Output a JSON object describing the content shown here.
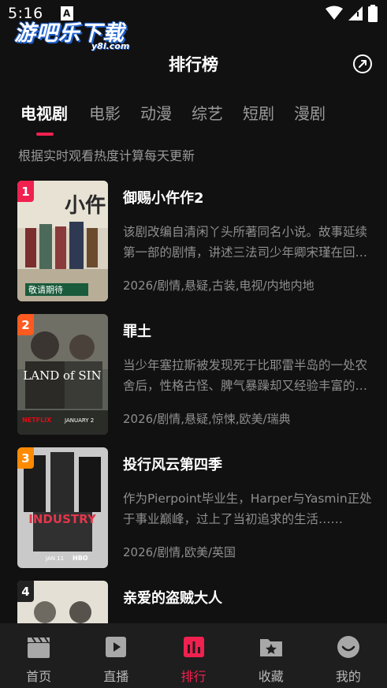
{
  "status": {
    "time": "5:16",
    "notif": "A"
  },
  "watermark": {
    "main": "游吧乐下载",
    "sub": "y8l.com"
  },
  "header": {
    "title": "排行榜"
  },
  "tabs": [
    "电视剧",
    "电影",
    "动漫",
    "综艺",
    "短剧",
    "漫剧"
  ],
  "subtitle": "根据实时观看热度计算每天更新",
  "items": [
    {
      "rank": "1",
      "title": "御赐小仵作2",
      "desc": "该剧改编自清闲丫头所著同名小说。故事延续第一部的剧情，讲述三法司少年卿宋瑾在回京途中，为调查一起离奇的案件……",
      "meta": "2026/剧情,悬疑,古装,电视/内地内地",
      "badge_color": "#f0214f",
      "poster_text": "敬请期待"
    },
    {
      "rank": "2",
      "title": "罪土",
      "desc": "当少年塞拉斯被发现死于比耶雷半岛的一处农舍后，性格古怪、脾气暴躁却又经验丰富的警探……",
      "meta": "2026/剧情,悬疑,惊悚,欧美/瑞典",
      "badge_color": "#ff5a1f",
      "poster_text": "LAND of SIN",
      "poster_brand": "NETFLIX",
      "poster_date": "JANUARY 2"
    },
    {
      "rank": "3",
      "title": "投行风云第四季",
      "desc": "作为Pierpoint毕业生，Harper与Yasmin正处于事业巅峰，过上了当初追求的生活……",
      "meta": "2026/剧情,欧美/英国",
      "badge_color": "#ff8a00",
      "poster_text": "INDUSTRY",
      "poster_brand": "HBO",
      "poster_date": "JAN 11"
    },
    {
      "rank": "4",
      "title": "亲爱的盗贼大人",
      "desc": "",
      "meta": "",
      "badge_color": "#222222"
    }
  ],
  "nav": [
    {
      "label": "首页",
      "icon": "clapperboard-icon"
    },
    {
      "label": "直播",
      "icon": "play-icon"
    },
    {
      "label": "排行",
      "icon": "ranking-bars-icon"
    },
    {
      "label": "收藏",
      "icon": "star-folder-icon"
    },
    {
      "label": "我的",
      "icon": "smile-icon"
    }
  ],
  "colors": {
    "accent": "#f0214f",
    "background": "#111111",
    "nav_background": "#1e1e1e"
  }
}
